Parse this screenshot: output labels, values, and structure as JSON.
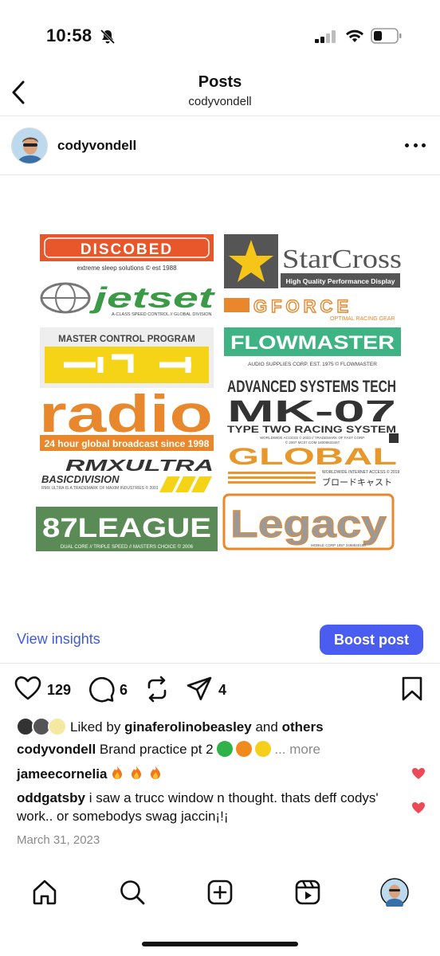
{
  "status_bar": {
    "time": "10:58"
  },
  "header": {
    "title": "Posts",
    "subtitle": "codyvondell"
  },
  "post": {
    "username": "codyvondell",
    "image_labels": {
      "discobed": "DISCOBED",
      "discobed_sub": "extreme sleep solutions © est 1988",
      "starcross": "StarCross",
      "starcross_sub": "High Quality Performance Display",
      "jetset": "jetset",
      "jetset_sub": "A-CLASS SPEED CONTROL // GLOBAL DIVISION",
      "gforce": "GFORCE",
      "gforce_sub": "OPTIMAL RACING GEAR",
      "mcp": "MASTER CONTROL PROGRAM",
      "flowmaster": "FLOWMASTER",
      "flowmaster_sub": "AUDIO SUPPLIES CORP. EST. 1975 © FLOWMASTER",
      "ast": "ADVANCED SYSTEMS TECH",
      "mk07": "MK-07",
      "mk07_sub": "TYPE TWO RACING SYSTEM",
      "mk07_fine1": "WORLDWIDE ACCESS © 2023 // TRADEMARK OF FAST CORP.",
      "mk07_fine2": "© 2007 MC07.COM 18008833467",
      "radio": "radio",
      "radio_sub": "24 hour global broadcast since 1998",
      "rmx": "RMXULTRA",
      "rmx_sub": "BASICDIVISION",
      "rmx_fine": "RMX ULTRA IS A TRADEMARK OF MAXIM INDUSTRIES © 2001",
      "global": "GLOBAL",
      "global_sub": "WORLDWIDE INTERNET ACCESS © 2019",
      "global_jp": "ブロードキャスト",
      "league": "87LEAGUE",
      "league_sub": "DUAL CORE // TRIPLE SPEED // MASTERS CHOICE © 2006",
      "legacy": "Legacy",
      "legacy_sub": "MOBILE CORP 1997 3498840198"
    },
    "view_insights": "View insights",
    "boost_post": "Boost post",
    "likes_count": "129",
    "comments_count": "6",
    "shares_count": "4",
    "liked_by_prefix": "Liked by",
    "liked_by_user": "ginaferolinobeasley",
    "liked_by_and": "and",
    "liked_by_others": "others",
    "caption_user": "codyvondell",
    "caption_text": "Brand practice pt 2",
    "caption_more": "... more",
    "comments": [
      {
        "user": "jameecornelia",
        "text": ""
      },
      {
        "user": "oddgatsby",
        "text": "i saw a trucc window n thought. thats deff codys' work.. or somebodys swag jaccin¡!¡"
      }
    ],
    "date": "March 31, 2023"
  },
  "colors": {
    "accent": "#4a5df0",
    "link": "#3f5bd8",
    "heart": "#ed4956"
  }
}
